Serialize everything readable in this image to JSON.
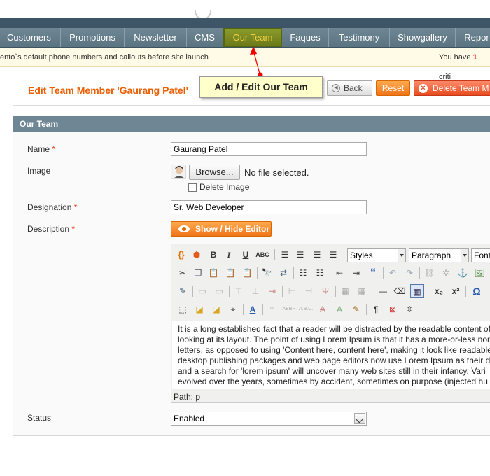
{
  "nav": {
    "items": [
      "Customers",
      "Promotions",
      "Newsletter",
      "CMS",
      "Our Team",
      "Faques",
      "Testimony",
      "Showgallery",
      "Repor"
    ],
    "active_index": 4
  },
  "notice": {
    "message": "ento`s default phone numbers and callouts before site launch",
    "right_prefix": "You have ",
    "right_count": "1",
    "right_suffix": " criti"
  },
  "header": {
    "title": "Edit Team Member 'Gaurang Patel'",
    "callout": "Add / Edit Our Team",
    "back_label": "Back",
    "reset_label": "Reset",
    "delete_label": "Delete Team M"
  },
  "panel": {
    "title": "Our Team",
    "fields": {
      "name_label": "Name",
      "name_value": "Gaurang Patel",
      "image_label": "Image",
      "browse_label": "Browse...",
      "no_file": "No file selected.",
      "delete_image_label": "Delete Image",
      "designation_label": "Designation",
      "designation_value": "Sr. Web Developer",
      "description_label": "Description",
      "show_hide_label": "Show / Hide Editor",
      "status_label": "Status",
      "status_value": "Enabled",
      "required_mark": "*"
    }
  },
  "editor": {
    "styles_select": "Styles",
    "format_select": "Paragraph",
    "font_select": "Font f",
    "content_lines": [
      "It is a long established fact that a reader will be distracted by the readable content of a",
      "looking at its layout. The point of using Lorem Ipsum is that it has a more-or-less norm",
      "letters, as opposed to using 'Content here, content here', making it look like readable",
      "desktop publishing packages and web page editors now use Lorem Ipsum as their d",
      "and a search for 'lorem ipsum' will uncover many web sites still in their infancy. Vari",
      "evolved over the years, sometimes by accident, sometimes on purpose (injected hu"
    ],
    "path": "Path: p"
  },
  "icons": {
    "toolbar": [
      "widget-icon",
      "magento-icon",
      "bold-icon",
      "italic-icon",
      "underline-icon",
      "strikethrough-icon",
      "align-left-icon",
      "align-center-icon",
      "align-right-icon",
      "justify-icon"
    ]
  }
}
